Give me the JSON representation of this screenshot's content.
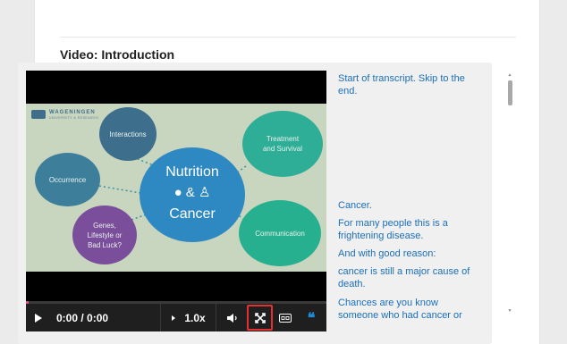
{
  "heading": "Video: Introduction",
  "slide": {
    "logo_text": "WAGENINGEN",
    "logo_sub": "UNIVERSITY & RESEARCH",
    "center_top": "Nutrition",
    "center_mid": "& ",
    "center_bot": "Cancer",
    "bubbles": {
      "interactions": "Interactions",
      "occurrence": "Occurrence",
      "genes": "Genes,\nLifestyle or\nBad Luck?",
      "treatment": "Treatment\nand Survival",
      "communication": "Communication"
    }
  },
  "controls": {
    "time": "0:00 / 0:00",
    "speed": "1.0x",
    "progress": 0.01,
    "icons": [
      "play-icon",
      "speed-arrow-icon",
      "volume-icon",
      "fullscreen-icon",
      "closed-captions-icon",
      "transcript-quote-icon"
    ]
  },
  "transcript": {
    "skip": "Start of transcript. Skip to the end.",
    "lines": [
      "Cancer.",
      "For many people this is a frightening disease.",
      "And with good reason:",
      "cancer is still a major cause of death.",
      "Chances are you know someone who had cancer or"
    ]
  },
  "colors": {
    "highlight": "#e53030",
    "transcript_link": "#1a6fba",
    "progress": "#d94f8a",
    "slide_bg": "#c8d5bf"
  }
}
